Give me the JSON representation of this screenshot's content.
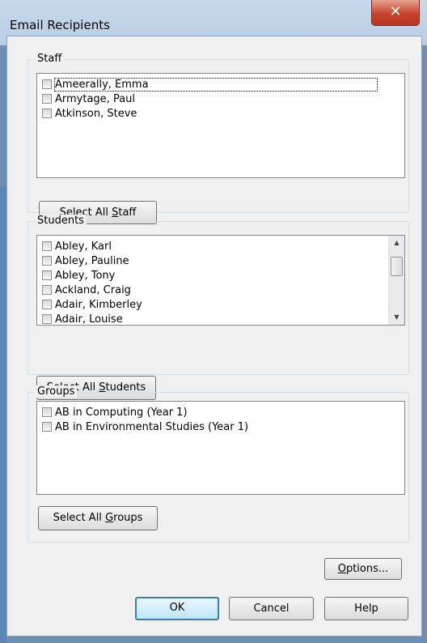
{
  "window": {
    "title": "Email Recipients",
    "close_glyph": "✕"
  },
  "staff": {
    "label": "Staff",
    "items": [
      "Ameerally, Emma",
      "Armytage, Paul",
      "Atkinson, Steve"
    ],
    "button_pre": "Select All ",
    "button_key": "S",
    "button_post": "taff"
  },
  "students": {
    "label": "Students",
    "items": [
      "Abley, Karl",
      "Abley, Pauline",
      "Abley, Tony",
      "Ackland, Craig",
      "Adair, Kimberley",
      "Adair, Louise"
    ],
    "button_pre": "Select All ",
    "button_key": "S",
    "button_post": "tudents"
  },
  "groups": {
    "label": "Groups",
    "items": [
      "AB in Computing (Year 1)",
      "AB in Environmental Studies (Year 1)"
    ],
    "button_pre": "Select All ",
    "button_key": "G",
    "button_post": "roups"
  },
  "buttons": {
    "options_key": "O",
    "options_rest": "ptions...",
    "ok": "OK",
    "cancel": "Cancel",
    "help": "Help"
  },
  "icons": {
    "scroll_up": "▲",
    "scroll_down": "▼"
  }
}
